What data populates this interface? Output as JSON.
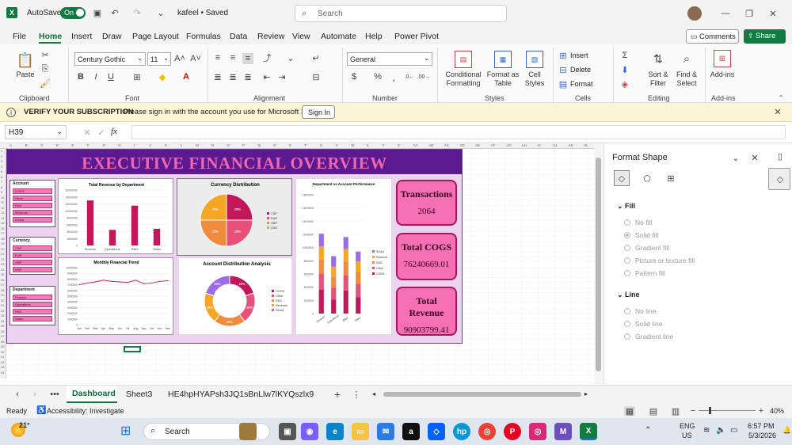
{
  "titlebar": {
    "autosave_label": "AutoSave",
    "autosave_state": "On",
    "file_status": "kafeel • Saved",
    "search_placeholder": "Search"
  },
  "tabs": [
    "File",
    "Home",
    "Insert",
    "Draw",
    "Page Layout",
    "Formulas",
    "Data",
    "Review",
    "View",
    "Automate",
    "Help",
    "Power Pivot"
  ],
  "tabs_right": {
    "comments": "Comments",
    "share": "Share"
  },
  "ribbon": {
    "clipboard": {
      "paste": "Paste",
      "label": "Clipboard"
    },
    "font": {
      "name": "Century Gothic",
      "size": "11",
      "label": "Font"
    },
    "alignment": {
      "label": "Alignment"
    },
    "number": {
      "format": "General",
      "label": "Number"
    },
    "styles": {
      "conditional": "Conditional Formatting",
      "format_table": "Format as Table",
      "cell_styles": "Cell Styles",
      "label": "Styles"
    },
    "cells": {
      "insert": "Insert",
      "delete": "Delete",
      "format": "Format",
      "label": "Cells"
    },
    "editing": {
      "sort": "Sort & Filter",
      "find": "Find & Select",
      "label": "Editing"
    },
    "addins": {
      "addins": "Add-ins",
      "label": "Add-ins"
    }
  },
  "notice": {
    "title": "VERIFY YOUR SUBSCRIPTION",
    "message": "Please sign in with the account you use for Microsoft 365",
    "button": "Sign In"
  },
  "formula": {
    "namebox": "H39",
    "fx": "fx"
  },
  "columns": [
    "A",
    "B",
    "C",
    "D",
    "E",
    "F",
    "G",
    "H",
    "I",
    "J",
    "K",
    "L",
    "M",
    "N",
    "O",
    "P",
    "Q",
    "R",
    "S",
    "T",
    "U",
    "V",
    "W",
    "X",
    "Y",
    "Z",
    "AA",
    "AB",
    "AC",
    "AD",
    "AE",
    "AF",
    "AG",
    "AH",
    "AI",
    "AJ",
    "AK",
    "AL"
  ],
  "dashboard": {
    "title": "EXECUTIVE FINANCIAL OVERVIEW",
    "slicer_account": {
      "title": "Account",
      "items": [
        "COGS",
        "Other",
        "R&D",
        "Revenue",
        "SG&A"
      ]
    },
    "slicer_currency": {
      "title": "Currency",
      "items": [
        "CSP",
        "EUR",
        "GBP",
        "USD"
      ]
    },
    "slicer_department": {
      "title": "Department",
      "items": [
        "Finance",
        "Operations",
        "R&D",
        "Sales"
      ]
    },
    "kpis": [
      {
        "title": "Transactions",
        "value": "2064"
      },
      {
        "title": "Total COGS",
        "value": "76240669.01"
      },
      {
        "title": "Total Revenue",
        "value": "90903799.41"
      }
    ],
    "chart_titles": {
      "revenue": "Total Revenue by Department",
      "currency": "Currency Distribution",
      "dept_account": "Department vs Account Performance",
      "trend": "Monthly Financial Trend",
      "account_dist": "Account Distribution Analysis"
    }
  },
  "chart_data": [
    {
      "type": "bar",
      "title": "Total Revenue by Department",
      "categories": [
        "Finance",
        "Operations",
        "R&D",
        "Sales"
      ],
      "values": [
        13000000,
        4500000,
        11500000,
        4800000
      ],
      "ylim": [
        0,
        16000000
      ],
      "yticks": [
        "16000000",
        "14000000",
        "12000000",
        "10000000",
        "8000000",
        "6000000",
        "4000000",
        "2000000",
        "0"
      ],
      "color": "#c2185b"
    },
    {
      "type": "pie",
      "title": "Currency Distribution",
      "slices": [
        {
          "name": "CSP",
          "value": 25,
          "color": "#c2185b"
        },
        {
          "name": "EUR",
          "value": 25,
          "color": "#e8507a"
        },
        {
          "name": "GBP",
          "value": 25,
          "color": "#f08a3c"
        },
        {
          "name": "USD",
          "value": 25,
          "color": "#f5a623"
        }
      ],
      "labels": [
        "25%",
        "25%",
        "25%",
        "25%"
      ],
      "legend": [
        "CSP",
        "EUR",
        "GBP",
        "USD"
      ]
    },
    {
      "type": "bar",
      "title": "Department vs Account Performance",
      "categories": [
        "Finance",
        "Operations",
        "R&D",
        "Sales"
      ],
      "series": [
        {
          "name": "COGS",
          "values": [
            3600000,
            2100000,
            3500000,
            2500000
          ],
          "color": "#c2185b"
        },
        {
          "name": "Other",
          "values": [
            2400000,
            1800000,
            2300000,
            2000000
          ],
          "color": "#e8507a"
        },
        {
          "name": "R&D",
          "values": [
            2200000,
            1700000,
            2100000,
            1800000
          ],
          "color": "#f08a3c"
        },
        {
          "name": "Revenue",
          "values": [
            2000000,
            1500000,
            1900000,
            1600000
          ],
          "color": "#f5a623"
        },
        {
          "name": "SG&A",
          "values": [
            1900000,
            1600000,
            1800000,
            1500000
          ],
          "color": "#9c6ce8"
        }
      ],
      "legend": [
        "SG&A",
        "Revenue",
        "R&D",
        "Other",
        "COGS"
      ],
      "ylim": [
        0,
        18000000
      ],
      "yticks": [
        "18000000",
        "16000000",
        "14000000",
        "12000000",
        "10000000",
        "8000000",
        "6000000",
        "4000000",
        "2000000",
        "0"
      ]
    },
    {
      "type": "line",
      "title": "Monthly Financial Trend",
      "categories": [
        "Jan",
        "Feb",
        "Mar",
        "Apr",
        "May",
        "Jun",
        "Jul",
        "Aug",
        "Sep",
        "Oct",
        "Nov",
        "Dec"
      ],
      "values": [
        7000000,
        7300000,
        7500000,
        7800000,
        7600000,
        7500000,
        7400000,
        7800000,
        7200000,
        7300000,
        7600000,
        7700000
      ],
      "ylim": [
        0,
        10000000
      ],
      "yticks": [
        "10000000",
        "9000000",
        "8000000",
        "7000000",
        "6000000",
        "5000000",
        "4000000",
        "3000000",
        "2000000",
        "1000000",
        "0"
      ],
      "color": "#c2185b"
    },
    {
      "type": "pie",
      "title": "Account Distribution Analysis",
      "donut": true,
      "slices": [
        {
          "name": "COGS",
          "value": 20,
          "color": "#c2185b"
        },
        {
          "name": "Other",
          "value": 20,
          "color": "#e8507a"
        },
        {
          "name": "R&D",
          "value": 20,
          "color": "#f08a3c"
        },
        {
          "name": "Revenue",
          "value": 20,
          "color": "#f5a623"
        },
        {
          "name": "SG&A",
          "value": 20,
          "color": "#9c6ce8"
        }
      ],
      "labels": [
        "20%",
        "20%",
        "20%",
        "20%",
        "20%"
      ],
      "legend": [
        "COGS",
        "Other",
        "R&D",
        "Revenue",
        "SG&A"
      ]
    }
  ],
  "pane": {
    "title": "Format Shape",
    "fill": "Fill",
    "fill_options": [
      "No fill",
      "Solid fill",
      "Gradient fill",
      "Picture or texture fill",
      "Pattern fill"
    ],
    "line": "Line",
    "line_options": [
      "No line",
      "Solid line",
      "Gradient line"
    ]
  },
  "sheets": [
    "Dashboard",
    "Sheet3",
    "HE4hpHYAPsh3JQ1sBnLlw7lKYQszlx9"
  ],
  "status": {
    "ready": "Ready",
    "accessibility": "Accessibility: Investigate",
    "zoom": "40%"
  },
  "taskbar": {
    "temp": "21°",
    "search": "Search",
    "lang1": "ENG",
    "lang2": "US",
    "time": "6:57 PM",
    "date": "5/3/2026"
  },
  "colors": {
    "accent": "#107c41",
    "brand_purple": "#5b1a8f",
    "title_pink": "#e91e63",
    "kpi_fill": "#f46fb3"
  }
}
